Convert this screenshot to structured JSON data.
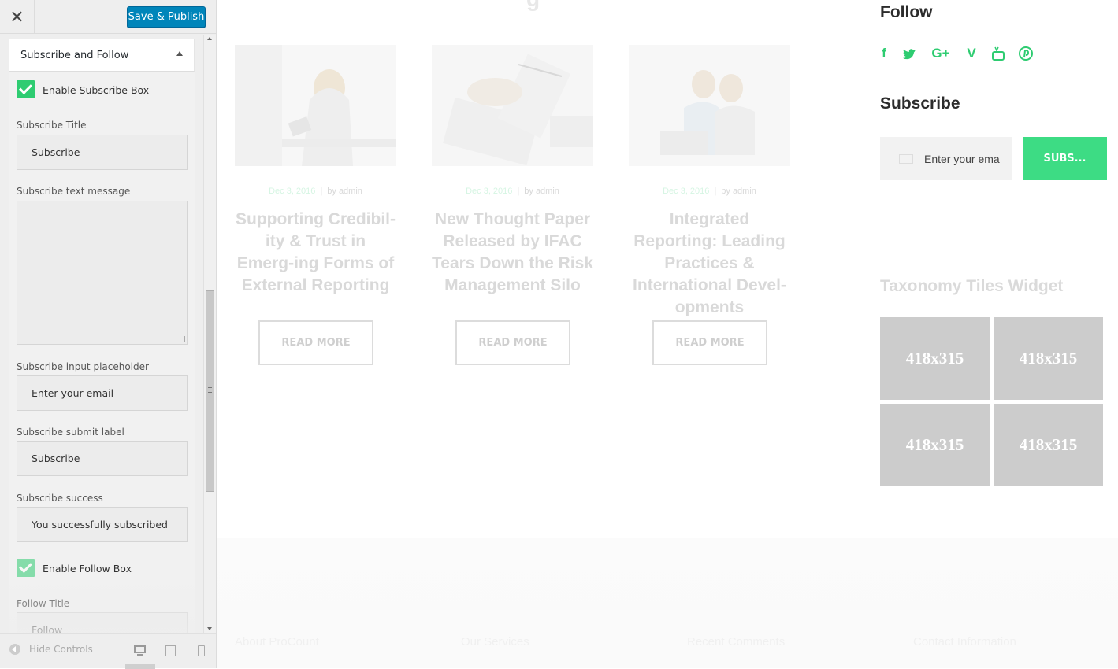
{
  "customizer": {
    "close_icon": "close-icon",
    "save_label": "Save & Publish",
    "section_title": "Subscribe and Follow",
    "enable_subscribe_label": "Enable Subscribe Box",
    "subscribe_title_label": "Subscribe Title",
    "subscribe_title_value": "Subscribe",
    "subscribe_text_label": "Subscribe text message",
    "subscribe_text_value": "",
    "input_placeholder_label": "Subscribe input placeholder",
    "input_placeholder_value": "Enter your email",
    "submit_label_label": "Subscribe submit label",
    "submit_label_value": "Subscribe",
    "success_label": "Subscribe success",
    "success_value": "You successfully subscribed",
    "enable_follow_label": "Enable Follow Box",
    "follow_title_label": "Follow Title",
    "follow_title_value": "Follow",
    "hide_controls_label": "Hide Controls",
    "accent_color": "#2ecc71",
    "button_color": "#0085ba"
  },
  "preview": {
    "heading_partial": "g",
    "posts": [
      {
        "date": "Dec 3, 2016",
        "author": "by admin",
        "separator": "|",
        "title": "Supporting Credibil-ity & Trust in Emerg-ing Forms of External Reporting",
        "button": "READ MORE"
      },
      {
        "date": "Dec 3, 2016",
        "author": "by admin",
        "separator": "|",
        "title": "New Thought Paper Released by IFAC Tears Down the Risk Management Silo",
        "button": "READ MORE"
      },
      {
        "date": "Dec 3, 2016",
        "author": "by admin",
        "separator": "|",
        "title": "Integrated Reporting: Leading Practices & International Devel-opments",
        "button": "READ MORE"
      }
    ],
    "follow_title": "Follow",
    "social_icons": [
      {
        "name": "facebook-icon",
        "glyph": "f"
      },
      {
        "name": "twitter-icon",
        "glyph": "🐦"
      },
      {
        "name": "google-plus-icon",
        "glyph": "G+"
      },
      {
        "name": "vimeo-icon",
        "glyph": "V"
      },
      {
        "name": "youtube-icon",
        "glyph": "▶"
      },
      {
        "name": "pinterest-icon",
        "glyph": "P"
      }
    ],
    "subscribe_title": "Subscribe",
    "subscribe_input_text": "Enter your ema",
    "subscribe_button": "SUBS...",
    "tiles_title": "Taxonomy Tiles Widget",
    "tiles": [
      "418x315",
      "418x315",
      "418x315",
      "418x315"
    ],
    "footer_headings": [
      "About ProCount",
      "Our Services",
      "Recent Comments",
      "Contact Information"
    ],
    "accent_color": "#3ddc84"
  }
}
